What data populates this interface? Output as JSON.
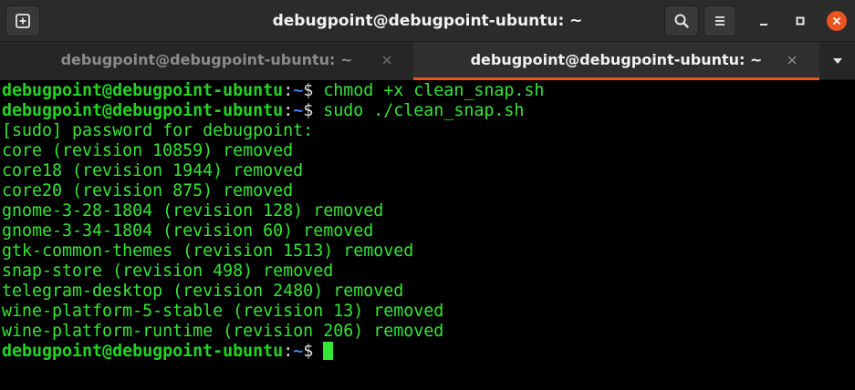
{
  "window": {
    "title": "debugpoint@debugpoint-ubuntu: ~",
    "colors": {
      "titlebar": "#2b2b2b",
      "close_button": "#e95420",
      "active_tab_indicator": "#e95420",
      "prompt_user": "#22d422",
      "prompt_path": "#3b7ff0",
      "output_text": "#33e633"
    }
  },
  "toolbar": {
    "new_tab_icon": "new-tab-icon",
    "search_icon": "search-icon",
    "menu_icon": "hamburger-menu-icon",
    "minimize_icon": "minimize-icon",
    "maximize_icon": "maximize-icon",
    "close_icon": "close-icon"
  },
  "tabs": [
    {
      "label": "debugpoint@debugpoint-ubuntu: ~",
      "active": false
    },
    {
      "label": "debugpoint@debugpoint-ubuntu: ~",
      "active": true
    }
  ],
  "terminal": {
    "prompt": {
      "user": "debugpoint@debugpoint-ubuntu",
      "colon": ":",
      "path": "~",
      "sign": "$ "
    },
    "commands": [
      "chmod +x clean_snap.sh",
      "sudo ./clean_snap.sh"
    ],
    "output": [
      "[sudo] password for debugpoint:",
      "core (revision 10859) removed",
      "core18 (revision 1944) removed",
      "core20 (revision 875) removed",
      "gnome-3-28-1804 (revision 128) removed",
      "gnome-3-34-1804 (revision 60) removed",
      "gtk-common-themes (revision 1513) removed",
      "snap-store (revision 498) removed",
      "telegram-desktop (revision 2480) removed",
      "wine-platform-5-stable (revision 13) removed",
      "wine-platform-runtime (revision 206) removed"
    ]
  }
}
